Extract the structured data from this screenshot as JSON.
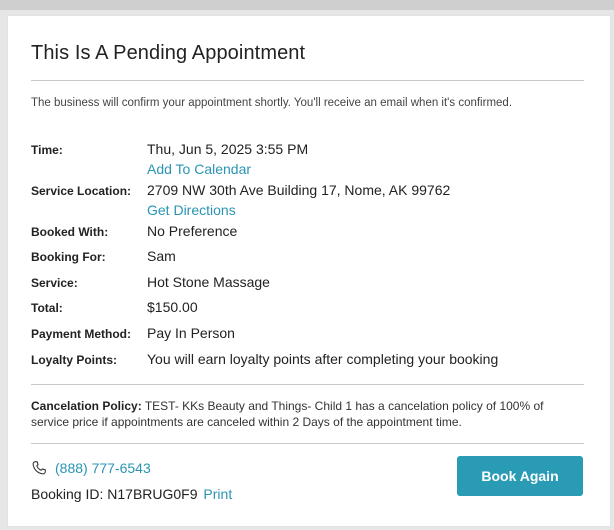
{
  "card": {
    "title": "This Is A Pending Appointment",
    "notice": "The business will confirm your appointment shortly. You'll receive an email when it's confirmed."
  },
  "details": {
    "time_label": "Time:",
    "time_value": "Thu, Jun 5, 2025 3:55 PM",
    "add_to_calendar": "Add To Calendar",
    "location_label": "Service Location:",
    "location_value": "2709 NW 30th Ave Building 17, Nome, AK 99762",
    "get_directions": "Get Directions",
    "booked_with_label": "Booked With:",
    "booked_with_value": "No Preference",
    "booking_for_label": "Booking For:",
    "booking_for_value": "Sam",
    "service_label": "Service:",
    "service_value": "Hot Stone Massage",
    "total_label": "Total:",
    "total_value": "$150.00",
    "payment_label": "Payment Method:",
    "payment_value": "Pay In Person",
    "loyalty_label": "Loyalty Points:",
    "loyalty_value": "You will earn loyalty points after completing your booking"
  },
  "policy": {
    "label": "Cancelation Policy:",
    "text": "TEST- KKs Beauty and Things- Child 1 has a cancelation policy of 100% of service price if appointments are canceled within 2 Days of the appointment time."
  },
  "footer": {
    "phone": "(888) 777-6543",
    "booking_id_label": "Booking ID:",
    "booking_id": "N17BRUG0F9",
    "print": "Print",
    "book_again": "Book Again",
    "phone_icon": "phone-icon"
  },
  "colors": {
    "accent": "#2a9bb5",
    "link": "#2a95b3"
  }
}
